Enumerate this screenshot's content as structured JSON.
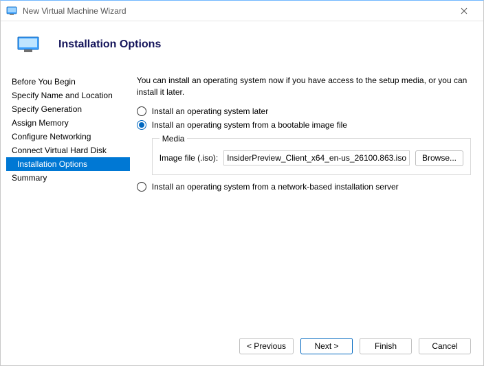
{
  "titlebar": {
    "title": "New Virtual Machine Wizard"
  },
  "header": {
    "title": "Installation Options"
  },
  "sidebar": {
    "items": [
      {
        "label": "Before You Begin"
      },
      {
        "label": "Specify Name and Location"
      },
      {
        "label": "Specify Generation"
      },
      {
        "label": "Assign Memory"
      },
      {
        "label": "Configure Networking"
      },
      {
        "label": "Connect Virtual Hard Disk"
      },
      {
        "label": "Installation Options"
      },
      {
        "label": "Summary"
      }
    ],
    "selected_index": 6
  },
  "main": {
    "intro": "You can install an operating system now if you have access to the setup media, or you can install it later.",
    "opt_later": "Install an operating system later",
    "opt_image": "Install an operating system from a bootable image file",
    "opt_network": "Install an operating system from a network-based installation server",
    "media_legend": "Media",
    "image_file_label": "Image file (.iso):",
    "image_file_value": "InsiderPreview_Client_x64_en-us_26100.863.iso",
    "browse_label": "Browse..."
  },
  "footer": {
    "previous": "< Previous",
    "next": "Next >",
    "finish": "Finish",
    "cancel": "Cancel"
  }
}
